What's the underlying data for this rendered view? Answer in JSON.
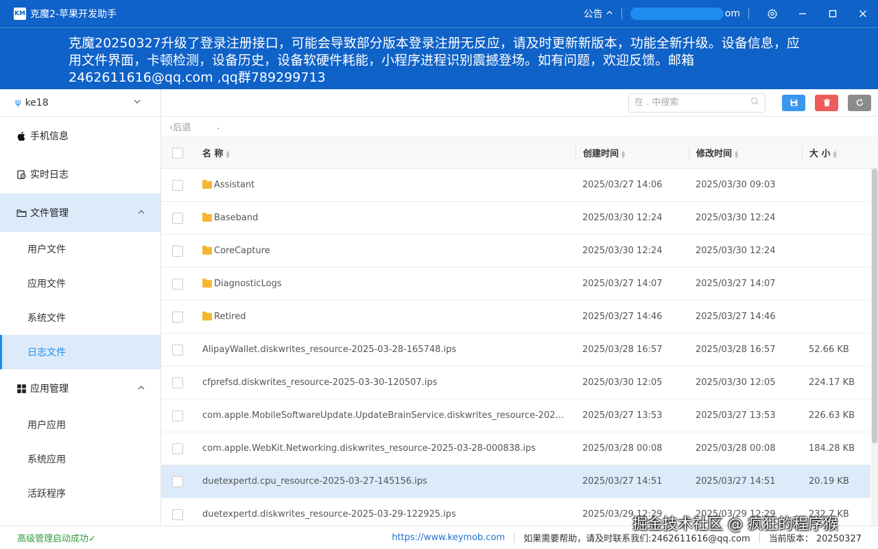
{
  "window": {
    "logo_text": "KM",
    "title": "克魔2-苹果开发助手",
    "notice_label": "公告",
    "account_suffix": "om"
  },
  "announcement": {
    "text": "克魔20250327升级了登录注册接口，可能会导致部分版本登录注册无反应，请及时更新新版本，功能全新升级。设备信息，应用文件界面，卡顿检测，设备历史，设备软硬件耗能，小程序进程识别震撼登场。如有问题，欢迎反馈。邮箱2462611616@qq.com ,qq群789299713"
  },
  "sidebar": {
    "device_name": "ke18",
    "items": [
      {
        "label": "手机信息",
        "icon": "apple-icon"
      },
      {
        "label": "实时日志",
        "icon": "log-icon"
      },
      {
        "label": "文件管理",
        "icon": "folder-outline-icon",
        "open": true,
        "children": [
          "用户文件",
          "应用文件",
          "系统文件",
          "日志文件"
        ],
        "active_child": "日志文件"
      },
      {
        "label": "应用管理",
        "icon": "apps-grid-icon",
        "open": true,
        "children": [
          "用户应用",
          "系统应用",
          "活跃程序"
        ]
      }
    ]
  },
  "toolbar": {
    "search_placeholder": "在 . 中搜索"
  },
  "path": {
    "back_label": "后退",
    "current": "."
  },
  "table": {
    "headers": {
      "name": "名 称",
      "created": "创建时间",
      "modified": "修改时间",
      "size": "大 小"
    },
    "rows": [
      {
        "type": "folder",
        "name": "Assistant",
        "created": "2025/03/27 14:06",
        "modified": "2025/03/30 09:03",
        "size": ""
      },
      {
        "type": "folder",
        "name": "Baseband",
        "created": "2025/03/30 12:24",
        "modified": "2025/03/30 12:24",
        "size": ""
      },
      {
        "type": "folder",
        "name": "CoreCapture",
        "created": "2025/03/30 12:24",
        "modified": "2025/03/30 12:24",
        "size": ""
      },
      {
        "type": "folder",
        "name": "DiagnosticLogs",
        "created": "2025/03/27 14:07",
        "modified": "2025/03/27 14:07",
        "size": ""
      },
      {
        "type": "folder",
        "name": "Retired",
        "created": "2025/03/27 14:46",
        "modified": "2025/03/27 14:46",
        "size": ""
      },
      {
        "type": "file",
        "name": "AlipayWallet.diskwrites_resource-2025-03-28-165748.ips",
        "created": "2025/03/28 16:57",
        "modified": "2025/03/28 16:57",
        "size": "52.66 KB"
      },
      {
        "type": "file",
        "name": "cfprefsd.diskwrites_resource-2025-03-30-120507.ips",
        "created": "2025/03/30 12:05",
        "modified": "2025/03/30 12:05",
        "size": "224.17 KB"
      },
      {
        "type": "file",
        "name": "com.apple.MobileSoftwareUpdate.UpdateBrainService.diskwrites_resource-2025-03-...",
        "created": "2025/03/27 13:53",
        "modified": "2025/03/27 13:53",
        "size": "226.63 KB"
      },
      {
        "type": "file",
        "name": "com.apple.WebKit.Networking.diskwrites_resource-2025-03-28-000838.ips",
        "created": "2025/03/28 00:08",
        "modified": "2025/03/28 00:08",
        "size": "184.28 KB"
      },
      {
        "type": "file",
        "name": "duetexpertd.cpu_resource-2025-03-27-145156.ips",
        "created": "2025/03/27 14:51",
        "modified": "2025/03/27 14:51",
        "size": "20.19 KB",
        "selected": true
      },
      {
        "type": "file",
        "name": "duetexpertd.diskwrites_resource-2025-03-29-122925.ips",
        "created": "2025/03/29 12:29",
        "modified": "2025/03/29 12:29",
        "size": "232.7 KB"
      }
    ]
  },
  "status": {
    "left": "高级管理启动成功✓",
    "website": "https://www.keymob.com",
    "help": "如果需要帮助，请及时联系我们:2462611616@qq.com",
    "version": "当前版本：   20250327"
  },
  "watermark": "掘金技术社区 @ 疯狂的程序猴",
  "colors": {
    "accent": "#0f62c7",
    "selected_bg": "#dceafa",
    "link": "#1d8cf0",
    "success": "#2e9a3e"
  }
}
